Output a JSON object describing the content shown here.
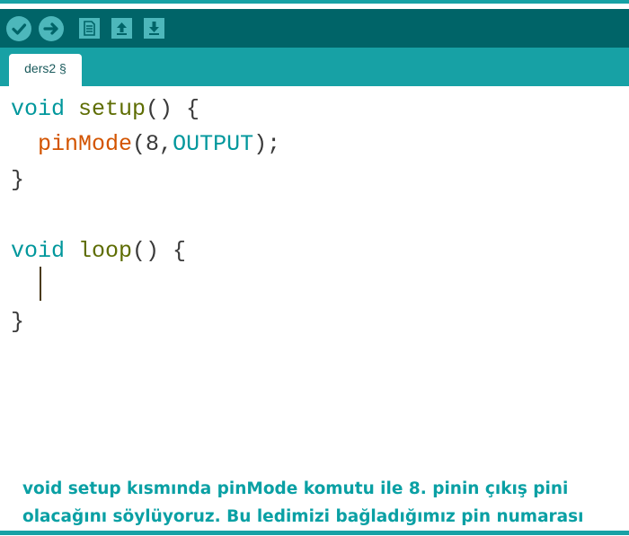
{
  "toolbar": {
    "buttons": [
      {
        "name": "verify",
        "icon": "check-icon"
      },
      {
        "name": "upload",
        "icon": "arrow-right-icon"
      },
      {
        "name": "new",
        "icon": "document-icon"
      },
      {
        "name": "open",
        "icon": "arrow-up-icon"
      },
      {
        "name": "save",
        "icon": "arrow-down-icon"
      }
    ]
  },
  "tabs": [
    {
      "label": "ders2 §"
    }
  ],
  "code": {
    "setup_line": {
      "type": "void",
      "name": "setup",
      "rest": "() {"
    },
    "pinmode_line": {
      "indent": "  ",
      "call": "pinMode",
      "open": "(8,",
      "arg": "OUTPUT",
      "close": ");"
    },
    "close_brace_1": "}",
    "loop_line": {
      "type": "void",
      "name": "loop",
      "rest": "() {"
    },
    "close_brace_2": "}"
  },
  "caption": {
    "line1": "void setup kısmında pinMode komutu ile 8. pinin çıkış pini",
    "line2": "olacağını söylüyoruz. Bu ledimizi bağladığımız pin numarası"
  },
  "colors": {
    "toolbar_bg": "#006468",
    "tabbar_bg": "#17a1a5",
    "button_bg": "#4db7bb",
    "keyword": "#00979c",
    "function": "#5e6d03",
    "call": "#d35400",
    "caption": "#0aa0a4"
  }
}
